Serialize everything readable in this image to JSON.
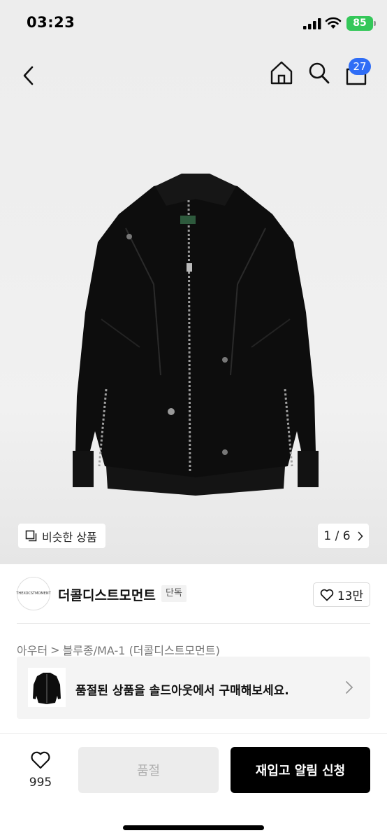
{
  "status_bar": {
    "time": "03:23",
    "battery": "85",
    "icons": [
      "signal-icon",
      "wifi-icon",
      "battery-icon"
    ]
  },
  "nav": {
    "cart_count": "27",
    "icons": [
      "back-chevron-icon",
      "home-icon",
      "search-icon",
      "shopping-bag-icon"
    ]
  },
  "hero": {
    "similar_label": "비슷한 상품",
    "page_indicator": "1 / 6"
  },
  "brand": {
    "logo_text": "THEXOCSTMOMENT",
    "name": "더콜디스트모먼트",
    "badge": "단독",
    "likes": "13만"
  },
  "breadcrumb": {
    "category": "아우터",
    "separator": ">",
    "subcategory": "블루종/MA-1 (더콜디스트모먼트)"
  },
  "banner": {
    "text": "품절된 상품을 솔드아웃에서 구매해보세요."
  },
  "bottom_bar": {
    "wish_count": "995",
    "soldout_label": "품절",
    "restock_label": "재입고 알림 신청"
  },
  "colors": {
    "accent_blue": "#2f6df6",
    "battery_green": "#34c759",
    "primary_black": "#000000"
  }
}
